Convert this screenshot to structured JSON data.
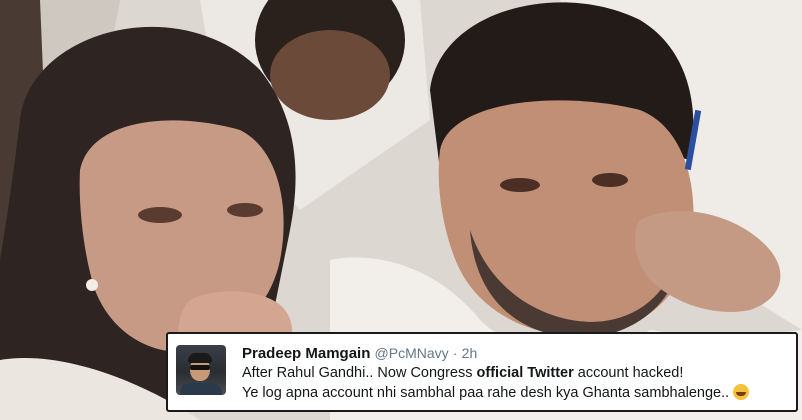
{
  "tweet": {
    "name": "Pradeep Mamgain",
    "handle": "@PcMNavy",
    "separator": "·",
    "time": "2h",
    "line1_part1": "After Rahul Gandhi.. Now Congress ",
    "line1_bold1": "official",
    "line1_space": " ",
    "line1_bold2": "Twitter",
    "line1_part2": " account hacked!",
    "line2": "Ye log apna account nhi sambhal paa rahe desh kya Ghanta sambhalenge..",
    "emoji_icon": "face-with-tears-of-joy-icon"
  },
  "colors": {
    "tweet_background": "#ffffff",
    "tweet_border": "#1a1a1a",
    "secondary_text": "#657786"
  }
}
